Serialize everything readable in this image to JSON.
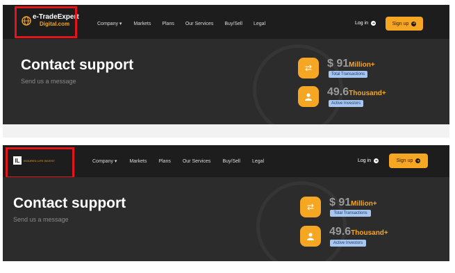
{
  "panel1": {
    "logo_line1": "e-TradeExpert",
    "logo_line2": "Digital.com",
    "menu": [
      "Company ▾",
      "Markets",
      "Plans",
      "Our Services",
      "Buy/Sell",
      "Legal"
    ],
    "login_label": "Log in",
    "signup_label": "Sign up",
    "title": "Contact support",
    "subtitle": "Send us a message",
    "stats": [
      {
        "value": "$ 91",
        "unit": "Million+",
        "label": "Total Transactions",
        "icon": "transfer-icon"
      },
      {
        "value": "49.6",
        "unit": "Thousand+",
        "label": "Active Investors",
        "icon": "user-icon"
      }
    ]
  },
  "panel2": {
    "logo_mark": "IL",
    "logo_name": "INSURED LIFE INVEST",
    "menu": [
      "Company ▾",
      "Markets",
      "Plans",
      "Our Services",
      "Buy/Sell",
      "Legal"
    ],
    "login_label": "Log in",
    "signup_label": "Sign up",
    "title": "Contact support",
    "subtitle": "Send us a message",
    "stats": [
      {
        "value": "$ 91",
        "unit": "Million+",
        "label": "Total Transactions",
        "icon": "transfer-icon"
      },
      {
        "value": "49.6",
        "unit": "Thousand+",
        "label": "Active Investors",
        "icon": "user-icon"
      }
    ]
  },
  "colors": {
    "accent": "#f5a623",
    "highlight": "#e4141b",
    "nav_bg": "#1d1d1d",
    "hero_bg": "#2c2c2c"
  }
}
